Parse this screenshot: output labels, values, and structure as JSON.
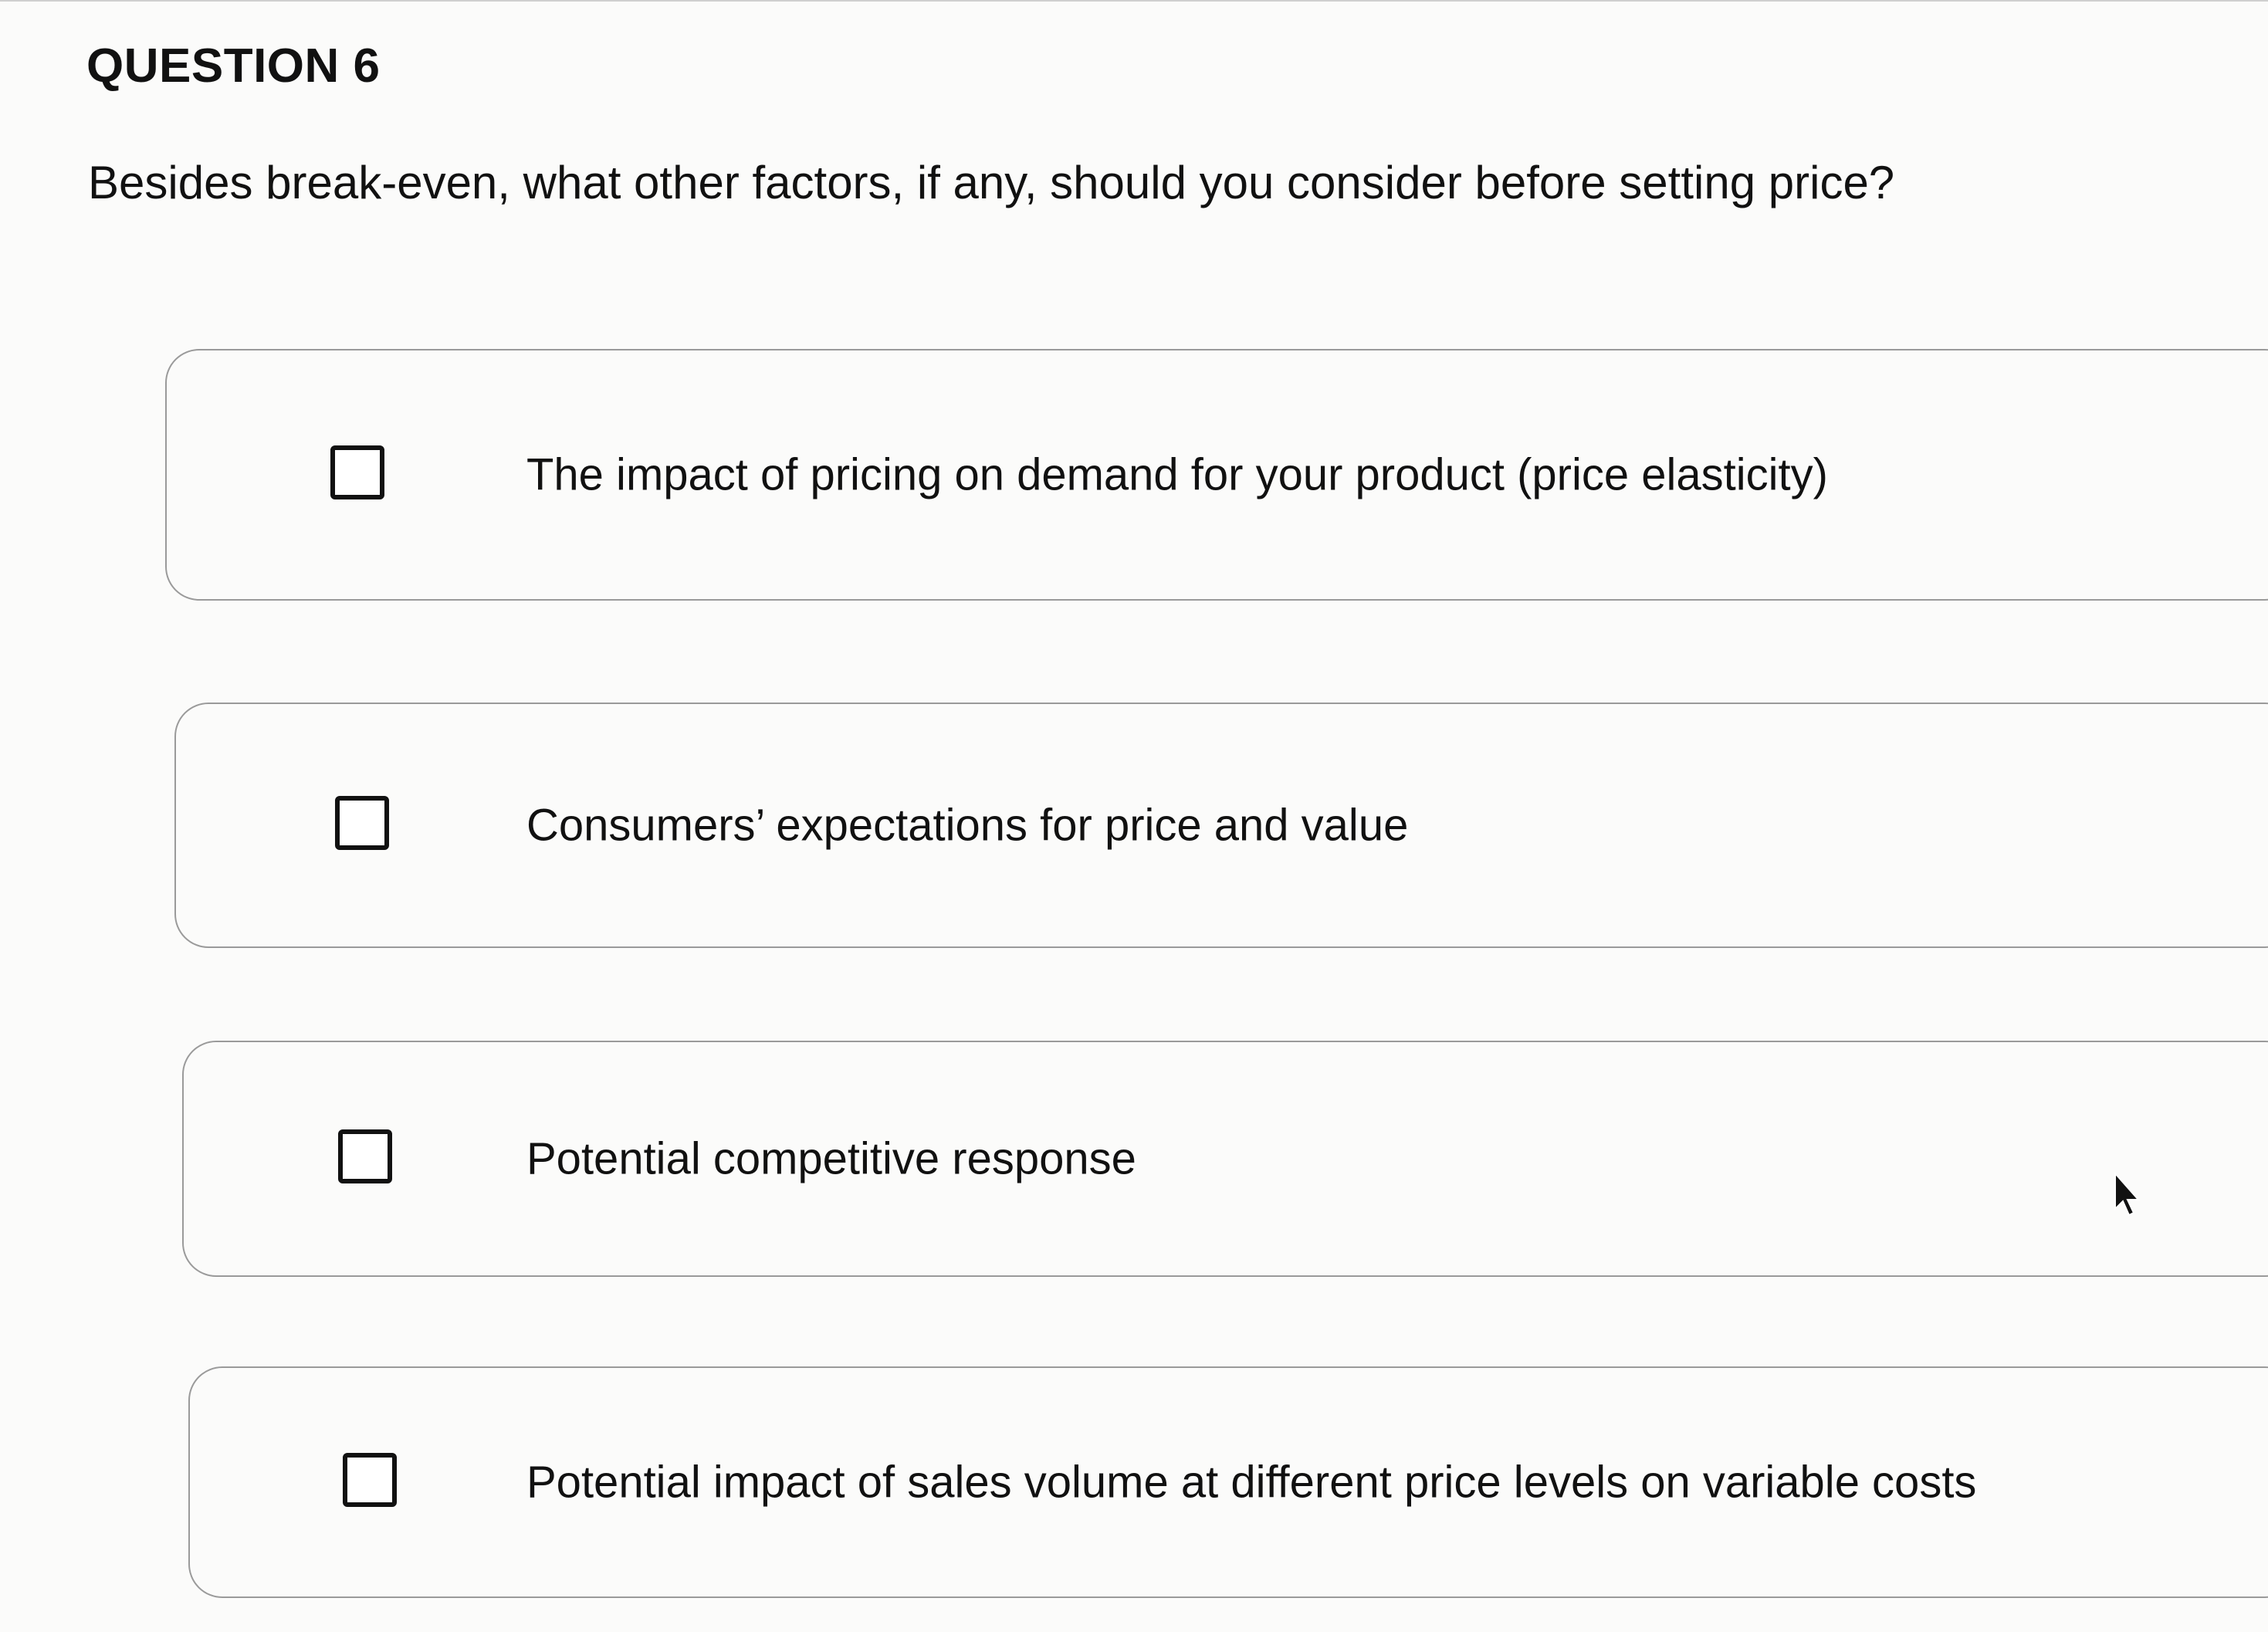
{
  "question": {
    "heading": "QUESTION 6",
    "text": "Besides break-even, what other factors, if any, should you consider before setting price?"
  },
  "options": [
    {
      "label": "The impact of pricing on demand for your product (price elasticity)",
      "checked": false
    },
    {
      "label": "Consumers’ expectations for price and value",
      "checked": false
    },
    {
      "label": "Potential competitive response",
      "checked": false
    },
    {
      "label": "Potential impact of sales volume at different price levels on variable costs",
      "checked": false
    }
  ],
  "icons": {
    "cursor": "mouse-pointer-icon",
    "checkbox": "unchecked-checkbox-icon"
  }
}
